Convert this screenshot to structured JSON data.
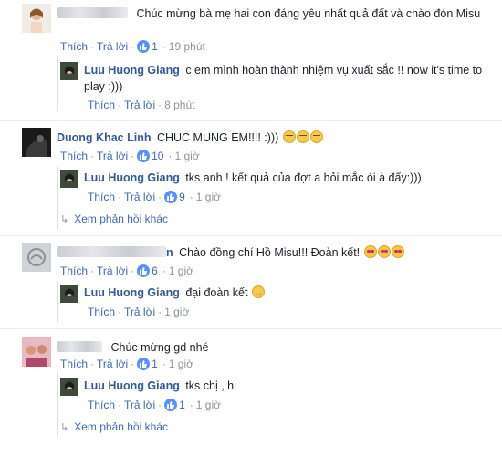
{
  "comments": [
    {
      "author": "",
      "text": "Chúc mừng bà mẹ hai con đáng yêu nhất quả đất và chào đón Misu",
      "like": "Thích",
      "reply": "Trả lời",
      "likes": "1",
      "time": "19 phút",
      "replies": [
        {
          "author": "Luu Huong Giang",
          "text": "c em mình hoàn thành nhiệm vụ xuất sắc !! now it's time to play :)))",
          "like": "Thích",
          "reply": "Trả lời",
          "time": "8 phút"
        }
      ]
    },
    {
      "author": "Duong Khac Linh",
      "text": "CHUC MUNG EM!!!! :)))",
      "like": "Thích",
      "reply": "Trả lời",
      "likes": "10",
      "time": "1 giờ",
      "replies": [
        {
          "author": "Luu Huong Giang",
          "text": "tks anh ! kết quả của đợt a hỏi mắc ói à đấy:)))",
          "like": "Thích",
          "reply": "Trả lời",
          "likes": "9",
          "time": "1 giờ"
        }
      ],
      "more_replies": "Xem phản hồi khác"
    },
    {
      "author_tail": "n",
      "text": "Chào đồng chí Hồ Misu!!! Đoàn kết!",
      "like": "Thích",
      "reply": "Trả lời",
      "likes": "6",
      "time": "1 giờ",
      "replies": [
        {
          "author": "Luu Huong Giang",
          "text": "đại đoàn kết",
          "like": "Thích",
          "reply": "Trả lời",
          "time": "1 giờ"
        }
      ]
    },
    {
      "author": "",
      "text": "Chúc mừng gd nhé",
      "like": "Thích",
      "reply": "Trả lời",
      "likes": "1",
      "time": "1 giờ",
      "replies": [
        {
          "author": "Luu Huong Giang",
          "text": "tks chị , hi",
          "like": "Thích",
          "reply": "Trả lời",
          "likes": "1",
          "time": "1 giờ"
        }
      ],
      "more_replies": "Xem phản hồi khác"
    }
  ],
  "colors": {
    "link": "#4267b2",
    "name": "#365899",
    "meta": "#90949c",
    "like_badge": "#5890ff"
  },
  "icons": [
    "like-icon",
    "reply-arrow-icon",
    "emoji-icon"
  ]
}
